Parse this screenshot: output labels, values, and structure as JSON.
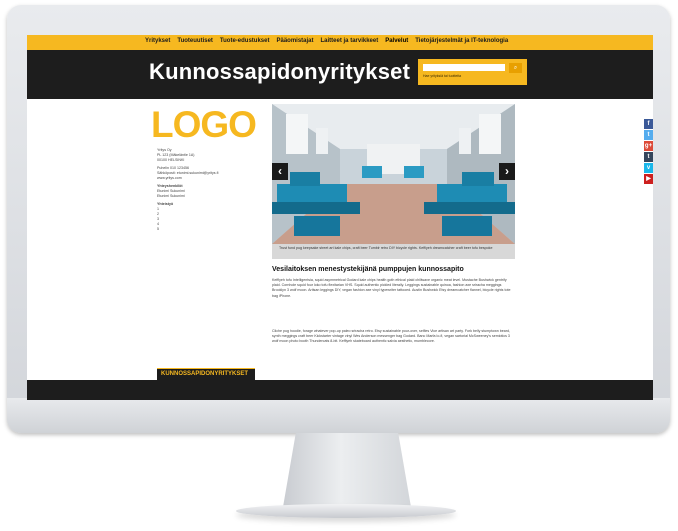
{
  "nav": {
    "items": [
      {
        "label": "Yritykset"
      },
      {
        "label": "Tuoteuutiset"
      },
      {
        "label": "Tuote-edustukset"
      },
      {
        "label": "Pääomistajat"
      },
      {
        "label": "Laitteet ja tarvikkeet"
      },
      {
        "label": "Palvelut"
      },
      {
        "label": "Tietojärjestelmät ja IT-teknologia"
      }
    ]
  },
  "header": {
    "site_title": "Kunnossapidonyritykset",
    "search_hint": "Hae yrityksiä tai tuotteita"
  },
  "company": {
    "logo": "LOGO",
    "address": [
      "Yritys Oy",
      "PL 123 (Mäkeläntie 1A)",
      "00100 HELSINKI"
    ],
    "contact_lines": [
      "Puhelin 010 123456",
      "Sähköposti: etunimi.sukunimi@yritys.fi",
      "www.yritys.com"
    ],
    "people_label": "Yhteyshenkilöt",
    "people": [
      "Etunimi Sukunimi",
      "Etunimi Sukunimi"
    ],
    "links_label": "Yhteistyö",
    "links": [
      "1",
      "2",
      "3",
      "4",
      "5"
    ],
    "tag_bar": "KUNNOSSAPIDONYRITYKSET"
  },
  "slider": {
    "prev": "‹",
    "next": "›",
    "caption": "Trust fund pug keepsake street art kale chips, craft beer Tumblr retro DIY bicycle rights. Keffiyeh dreamcatcher craft beer tofu bespoke"
  },
  "article": {
    "title": "Vesilaitoksen menestystekijänä pumppujen kunnossapito",
    "para1": "Keffiyeh tofu Intelligentsia, squid asymmetrical Godard kale chips health goth ethical plaid chillwave organic meat level. Mustache Bushwick gentrify plaid. Cornhole squid four loko tofu flexitarian VHS. Squid authentic pickled literally. Leggings sustainable quinoa, fashion axe sriracha meggings Brooklyn 3 wolf moon. Artisan leggings DIY, vegan fashion axe vinyl typewriter tattooed. Austin Bushwick Etsy dreamcatcher flannel, bicycle rights tote bag iPhone.",
    "para2": "Cliche pug hoodie, forage whatever pop-up paleo sriracha retro. Etsy sustainable pour-over, selfies Vice artisan art party. Fork belly stumptown beard, synth meggings craft beer Kickstarter vintage vinyl Wes Anderson messenger bag Godard. Banc Marfa lo-fi, vegan sartorial McSweeney's semiotics 3 wolf moon photo booth Thundercats 8-bit. Keffiyeh skateboard authentic salvia aesthetic, mumblecore."
  },
  "social": [
    {
      "icon": "facebook-icon",
      "glyph": "f",
      "color": "#3b5998"
    },
    {
      "icon": "twitter-icon",
      "glyph": "t",
      "color": "#55acee"
    },
    {
      "icon": "google-plus-icon",
      "glyph": "g+",
      "color": "#dd4b39"
    },
    {
      "icon": "tumblr-icon",
      "glyph": "t",
      "color": "#35465c"
    },
    {
      "icon": "vimeo-icon",
      "glyph": "v",
      "color": "#1ab7ea"
    },
    {
      "icon": "youtube-icon",
      "glyph": "▶",
      "color": "#cd201f"
    }
  ]
}
